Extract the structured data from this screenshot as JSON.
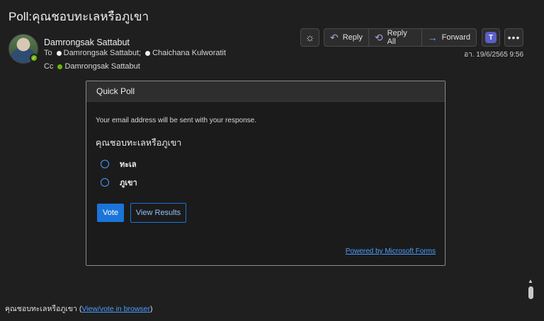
{
  "subject": "Poll:คุณชอบทะเลหรือภูเขา",
  "sender": {
    "name": "Damrongsak Sattabut",
    "to_label": "To",
    "cc_label": "Cc",
    "to": [
      "Damrongsak Sattabut;",
      "Chaichana Kulworatit"
    ],
    "cc": [
      "Damrongsak Sattabut"
    ],
    "date": "อา. 19/6/2565 9:56"
  },
  "toolbar": {
    "reply": "Reply",
    "reply_all": "Reply All",
    "forward": "Forward",
    "more": "•••",
    "teams_letter": "T"
  },
  "poll": {
    "title": "Quick Poll",
    "notice": "Your email address will be sent with your response.",
    "question": "คุณชอบทะเลหรือภูเขา",
    "options": [
      "ทะเล",
      "ภูเขา"
    ],
    "vote_label": "Vote",
    "results_label": "View Results",
    "powered_by": "Powered by Microsoft Forms"
  },
  "footer": {
    "question": "คุณชอบทะเลหรือภูเขา",
    "link_text": "View/vote in browser"
  },
  "icons": {
    "theme": "sun-icon",
    "reply": "reply-arrow-icon",
    "reply_all": "reply-all-arrow-icon",
    "forward": "forward-arrow-icon",
    "teams": "teams-icon",
    "more": "more-icon"
  },
  "colors": {
    "accent": "#1b74d9",
    "link": "#4a9eff",
    "presence": "#6bb700",
    "background": "#1f1f1f"
  }
}
